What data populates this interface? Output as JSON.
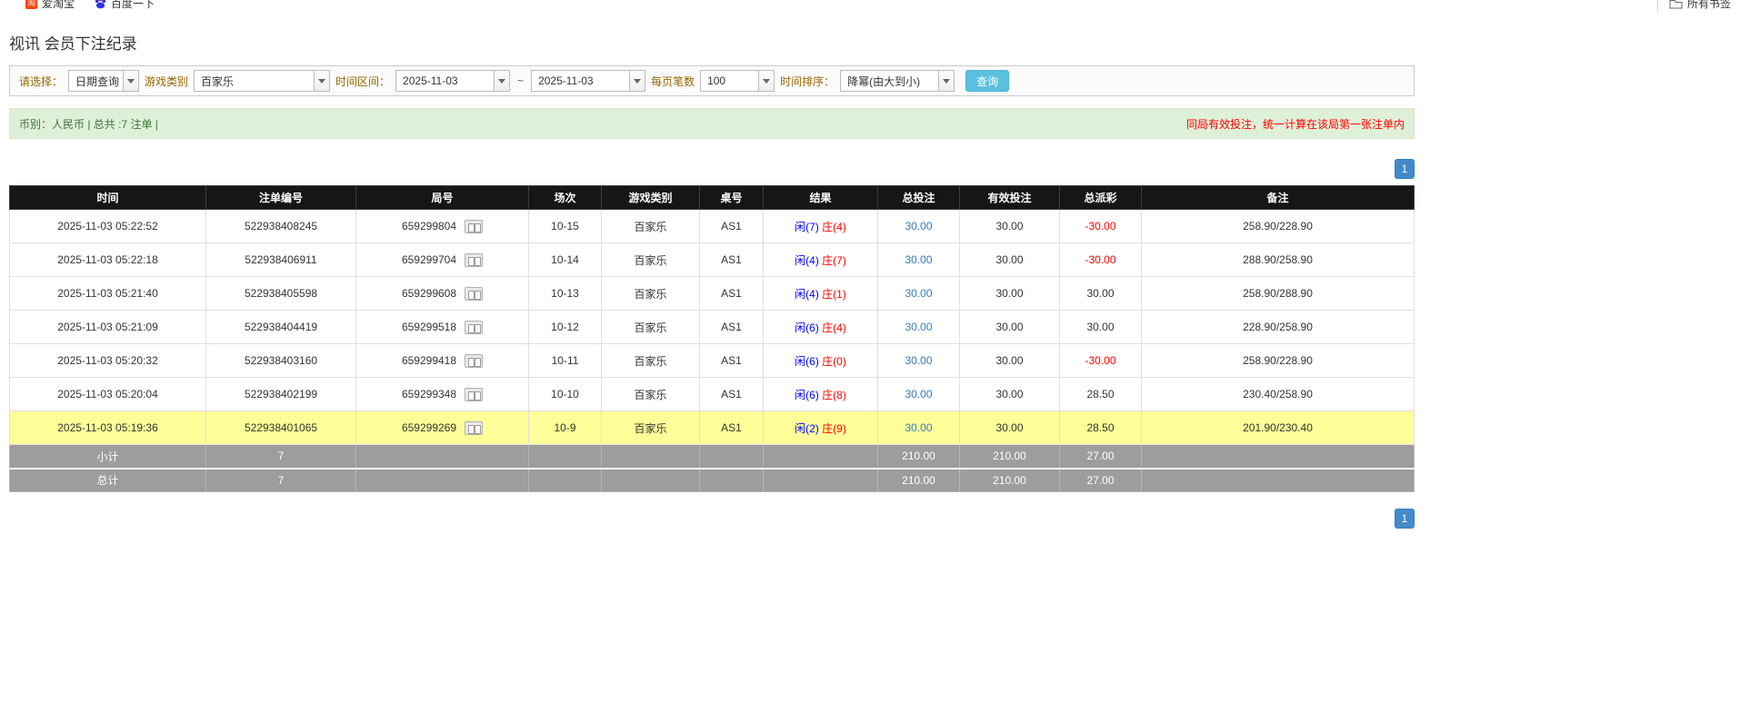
{
  "bookmarks_bar": {
    "items": [
      {
        "label": "爱淘宝",
        "icon": "taobao-icon"
      },
      {
        "label": "百度一下",
        "icon": "baidu-icon"
      }
    ],
    "all_bookmarks_label": "所有书签",
    "all_bookmarks_icon": "folder-icon"
  },
  "page_title": "视讯 会员下注纪录",
  "filter_bar": {
    "query_type": {
      "label": "请选择：",
      "value": "日期查询"
    },
    "game_type": {
      "label": "游戏类别",
      "value": "百家乐"
    },
    "time_range": {
      "label": "时间区间：",
      "from": "2025-11-03",
      "separator": "~",
      "to": "2025-11-03"
    },
    "page_size": {
      "label": "每页笔数",
      "value": "100"
    },
    "sort": {
      "label": "时间排序：",
      "value": "降幂(由大到小)"
    },
    "search_button_label": "查询"
  },
  "summary_bar": {
    "currency_info": "币别：人民币 | 总共 :7 注单 |",
    "note": "同局有效投注，统一计算在该局第一张注单内"
  },
  "pagination": {
    "current_page": "1"
  },
  "table": {
    "headers": [
      "时间",
      "注单编号",
      "局号",
      "场次",
      "游戏类别",
      "桌号",
      "结果",
      "总投注",
      "有效投注",
      "总派彩",
      "备注"
    ],
    "rows": [
      {
        "time": "2025-11-03 05:22:52",
        "bet_id": "522938408245",
        "round": "659299804",
        "session": "10-15",
        "game": "百家乐",
        "table_no": "AS1",
        "result": {
          "player": "闲(7)",
          "banker": "庄(4)"
        },
        "total_bet": "30.00",
        "valid_bet": "30.00",
        "total_payout": "-30.00",
        "note": "258.90/228.90",
        "highlight": false
      },
      {
        "time": "2025-11-03 05:22:18",
        "bet_id": "522938406911",
        "round": "659299704",
        "session": "10-14",
        "game": "百家乐",
        "table_no": "AS1",
        "result": {
          "player": "闲(4)",
          "banker": "庄(7)"
        },
        "total_bet": "30.00",
        "valid_bet": "30.00",
        "total_payout": "-30.00",
        "note": "288.90/258.90",
        "highlight": false
      },
      {
        "time": "2025-11-03 05:21:40",
        "bet_id": "522938405598",
        "round": "659299608",
        "session": "10-13",
        "game": "百家乐",
        "table_no": "AS1",
        "result": {
          "player": "闲(4)",
          "banker": "庄(1)"
        },
        "total_bet": "30.00",
        "valid_bet": "30.00",
        "total_payout": "30.00",
        "note": "258.90/288.90",
        "highlight": false
      },
      {
        "time": "2025-11-03 05:21:09",
        "bet_id": "522938404419",
        "round": "659299518",
        "session": "10-12",
        "game": "百家乐",
        "table_no": "AS1",
        "result": {
          "player": "闲(6)",
          "banker": "庄(4)"
        },
        "total_bet": "30.00",
        "valid_bet": "30.00",
        "total_payout": "30.00",
        "note": "228.90/258.90",
        "highlight": false
      },
      {
        "time": "2025-11-03 05:20:32",
        "bet_id": "522938403160",
        "round": "659299418",
        "session": "10-11",
        "game": "百家乐",
        "table_no": "AS1",
        "result": {
          "player": "闲(6)",
          "banker": "庄(0)"
        },
        "total_bet": "30.00",
        "valid_bet": "30.00",
        "total_payout": "-30.00",
        "note": "258.90/228.90",
        "highlight": false
      },
      {
        "time": "2025-11-03 05:20:04",
        "bet_id": "522938402199",
        "round": "659299348",
        "session": "10-10",
        "game": "百家乐",
        "table_no": "AS1",
        "result": {
          "player": "闲(6)",
          "banker": "庄(8)"
        },
        "total_bet": "30.00",
        "valid_bet": "30.00",
        "total_payout": "28.50",
        "note": "230.40/258.90",
        "highlight": false
      },
      {
        "time": "2025-11-03 05:19:36",
        "bet_id": "522938401065",
        "round": "659299269",
        "session": "10-9",
        "game": "百家乐",
        "table_no": "AS1",
        "result": {
          "player": "闲(2)",
          "banker": "庄(9)"
        },
        "total_bet": "30.00",
        "valid_bet": "30.00",
        "total_payout": "28.50",
        "note": "201.90/230.40",
        "highlight": true
      }
    ],
    "subtotal_row": {
      "label": "小计",
      "count": "7",
      "total_bet": "210.00",
      "valid_bet": "210.00",
      "total_payout": "27.00"
    },
    "grand_total_row": {
      "label": "总计",
      "count": "7",
      "total_bet": "210.00",
      "valid_bet": "210.00",
      "total_payout": "27.00"
    }
  },
  "colors": {
    "player_blue": "#0000ff",
    "banker_red": "#ff0000",
    "link_blue": "#337ab7",
    "negative_red": "#ff0000",
    "highlight_yellow": "#ffff99",
    "header_black": "#161616",
    "summary_gray": "#9d9d9d",
    "success_green_bg": "#dff0d8",
    "search_button_blue": "#5bc0de",
    "pagination_blue": "#428bca"
  }
}
